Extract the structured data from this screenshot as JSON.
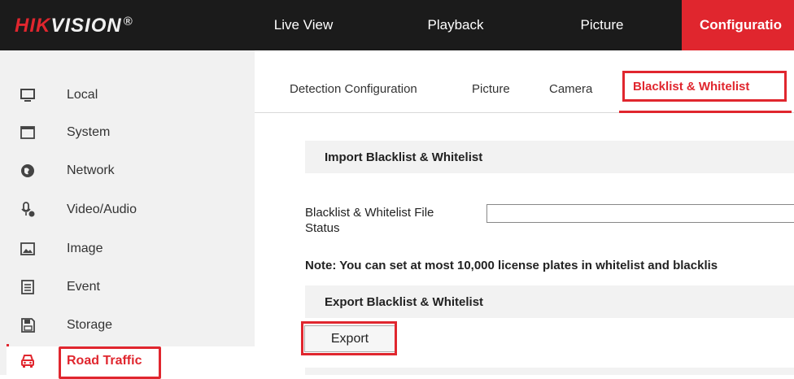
{
  "header": {
    "logo_brand": "HIK",
    "logo_rest": "VISION",
    "logo_reg": "®",
    "nav": [
      {
        "label": "Live View"
      },
      {
        "label": "Playback"
      },
      {
        "label": "Picture"
      },
      {
        "label": "Configuratio"
      }
    ],
    "colors": {
      "topbar": "#1b1b1b",
      "accent": "#e0262e"
    }
  },
  "sidebar": {
    "items": [
      {
        "label": "Local",
        "icon": "monitor-icon"
      },
      {
        "label": "System",
        "icon": "window-icon"
      },
      {
        "label": "Network",
        "icon": "globe-icon"
      },
      {
        "label": "Video/Audio",
        "icon": "microphone-icon"
      },
      {
        "label": "Image",
        "icon": "image-icon"
      },
      {
        "label": "Event",
        "icon": "list-icon"
      },
      {
        "label": "Storage",
        "icon": "disk-icon"
      },
      {
        "label": "Road Traffic",
        "icon": "car-icon"
      }
    ]
  },
  "tabs": [
    {
      "label": "Detection Configuration"
    },
    {
      "label": "Picture"
    },
    {
      "label": "Camera"
    },
    {
      "label": "Blacklist & Whitelist"
    }
  ],
  "main": {
    "import_title": "Import Blacklist & Whitelist",
    "file_label": "Blacklist & Whitelist File",
    "file_value": "",
    "status_label": "Status",
    "note": "Note: You can set at most 10,000 license plates in whitelist and blacklis",
    "export_title": "Export Blacklist & Whitelist",
    "export_button": "Export"
  }
}
